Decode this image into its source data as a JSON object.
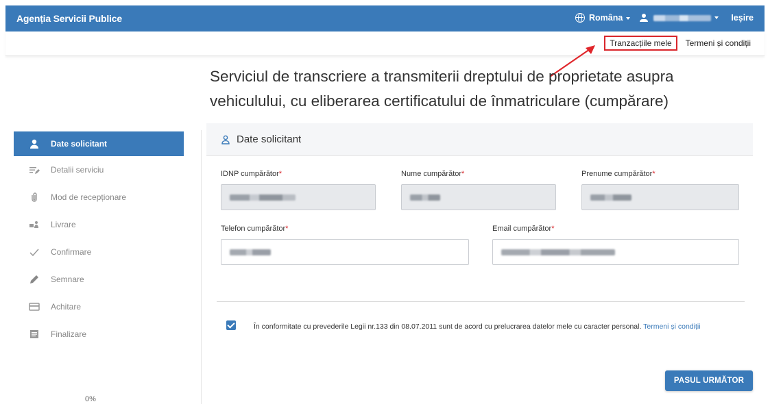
{
  "header": {
    "brand": "Agenția Servicii Publice",
    "language": "Româna",
    "user_name": "",
    "logout": "Ieșire"
  },
  "subnav": {
    "transactions": "Tranzacțiile mele",
    "terms": "Termeni și condiții"
  },
  "page": {
    "title": "Serviciul de transcriere a transmiterii dreptului de proprietate asupra vehiculului, cu eliberarea certificatului de înmatriculare (cumpărare)"
  },
  "sidebar": {
    "items": [
      {
        "label": "Date solicitant",
        "icon": "user-icon",
        "active": true
      },
      {
        "label": "Detalii serviciu",
        "icon": "list-edit-icon",
        "active": false
      },
      {
        "label": "Mod de recepționare",
        "icon": "paperclip-icon",
        "active": false
      },
      {
        "label": "Livrare",
        "icon": "delivery-icon",
        "active": false
      },
      {
        "label": "Confirmare",
        "icon": "check-icon",
        "active": false
      },
      {
        "label": "Semnare",
        "icon": "pen-icon",
        "active": false
      },
      {
        "label": "Achitare",
        "icon": "card-icon",
        "active": false
      },
      {
        "label": "Finalizare",
        "icon": "document-icon",
        "active": false
      }
    ],
    "progress": "0%"
  },
  "section": {
    "title": "Date solicitant"
  },
  "form": {
    "idnp_label": "IDNP cumpărător",
    "nume_label": "Nume cumpărător",
    "prenume_label": "Prenume cumpărător",
    "telefon_label": "Telefon cumpărător",
    "email_label": "Email cumpărător",
    "required_mark": "*"
  },
  "consent": {
    "text": "În conformitate cu prevederile Legii nr.133 din 08.07.2011 sunt de acord cu prelucrarea datelor mele cu caracter personal.",
    "link": "Termeni și condiții",
    "checked": true
  },
  "actions": {
    "next": "PASUL URMĂTOR"
  },
  "colors": {
    "primary": "#3a7ab9",
    "highlight": "#d9262b"
  }
}
